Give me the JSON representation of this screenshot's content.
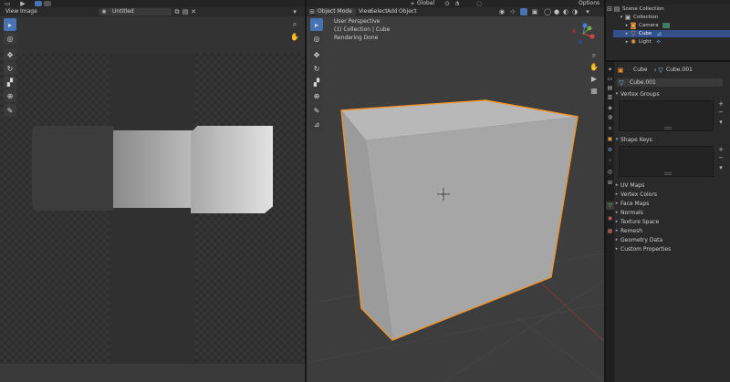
{
  "image_editor": {
    "menu": [
      "View",
      "Image"
    ],
    "image_name": "Untitled"
  },
  "viewport": {
    "mode": "Object Mode",
    "menu": [
      "View",
      "Select",
      "Add",
      "Object"
    ],
    "transform_orientation": "Global",
    "overlay_lines": [
      "User Perspective",
      "(1) Collection | Cube",
      "Rendering Done"
    ]
  },
  "topbar": {
    "options": "Options"
  },
  "outliner": {
    "items": [
      {
        "label": "Scene Collection",
        "icon": "scene-collection-icon"
      },
      {
        "label": "Collection",
        "icon": "collection-icon"
      },
      {
        "label": "Camera",
        "icon": "camera-icon"
      },
      {
        "label": "Cube",
        "icon": "mesh-icon",
        "selected": true
      },
      {
        "label": "Light",
        "icon": "light-icon"
      }
    ]
  },
  "properties": {
    "object_name": "Cube",
    "mesh_name": "Cube.001",
    "datablock": "Cube.001",
    "sections": [
      "Vertex Groups",
      "Shape Keys"
    ],
    "collapsed": [
      "UV Maps",
      "Vertex Colors",
      "Face Maps",
      "Normals",
      "Texture Space",
      "Remesh",
      "Geometry Data",
      "Custom Properties"
    ]
  },
  "colors": {
    "accent": "#4772b3",
    "selection_outline": "#f0952c",
    "header_bg": "#2a2a2a",
    "viewport_bg": "#3d3d3d"
  }
}
